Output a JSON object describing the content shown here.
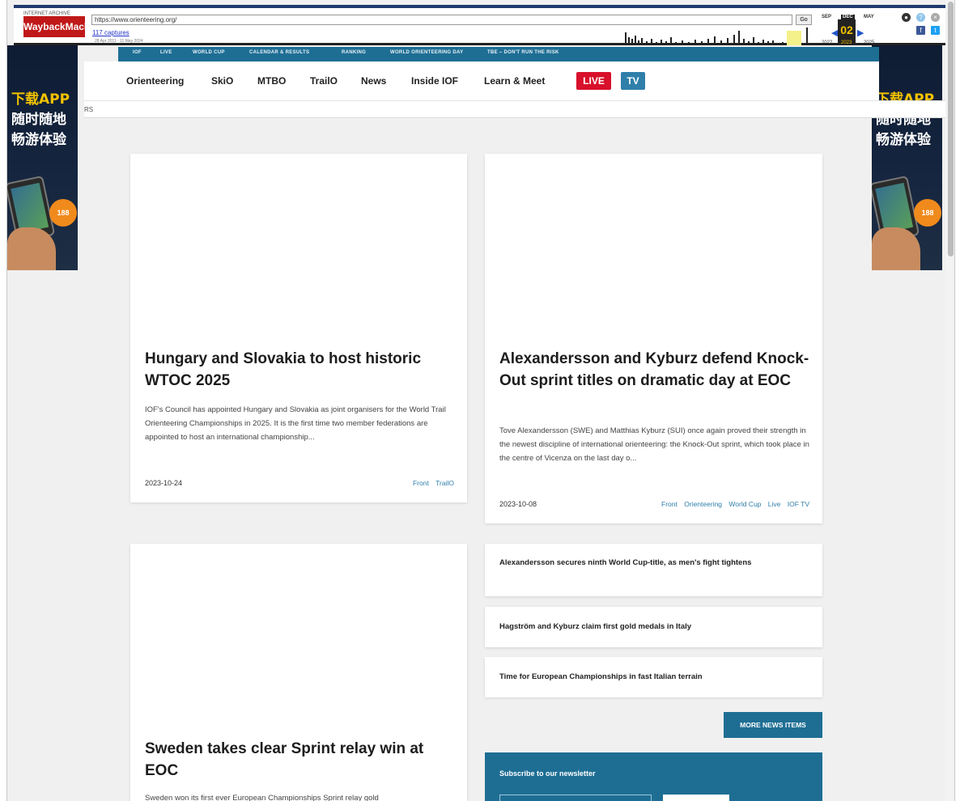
{
  "wayback": {
    "logo_top": "INTERNET ARCHIVE",
    "logo": "WaybackMachine",
    "url": "https://www.orienteering.org/",
    "go_label": "Go",
    "captures": "117 captures",
    "range": "28 Apr 2011 - 11 May 2024",
    "months": [
      "SEP",
      "DEC",
      "MAY"
    ],
    "day": "02",
    "years": [
      "2022",
      "2023",
      "2025"
    ]
  },
  "ad": {
    "line1": "下载APP",
    "line2": "随时随地",
    "line3": "畅游体验",
    "badge": "188"
  },
  "topbar": {
    "items": [
      "IOF",
      "LIVE",
      "WORLD CUP",
      "CALENDAR & RESULTS",
      "RANKING",
      "WORLD ORIENTEERING DAY",
      "TBE – DON'T RUN THE RISK"
    ]
  },
  "nav": {
    "items": [
      "Orienteering",
      "SkiO",
      "MTBO",
      "TrailO",
      "News",
      "Inside IOF",
      "Learn & Meet"
    ],
    "live": "LIVE",
    "tv": "TV"
  },
  "subbar": {
    "text": "RS"
  },
  "cards": [
    {
      "title": "Hungary and Slovakia to host historic WTOC 2025",
      "excerpt": "IOF's Council has appointed Hungary and Slovakia as joint organisers for the World Trail Orienteering Championships in 2025. It is the first time two member federations are appointed to host an international championship...",
      "date": "2023-10-24",
      "tags": [
        "Front",
        "TrailO"
      ]
    },
    {
      "title": "Alexandersson and Kyburz defend Knock-Out sprint titles on dramatic day at EOC",
      "excerpt": "Tove Alexandersson (SWE) and Matthias Kyburz (SUI) once again proved their strength in the newest discipline of international orienteering: the Knock-Out sprint, which took place in the centre of Vicenza on the last day o...",
      "date": "2023-10-08",
      "tags": [
        "Front",
        "Orienteering",
        "World Cup",
        "Live",
        "IOF TV"
      ]
    },
    {
      "title": "Sweden takes clear Sprint relay win at EOC",
      "excerpt": "Sweden won its first ever European Championships Sprint relay gold",
      "date": "",
      "tags": []
    }
  ],
  "news_list": [
    "Alexandersson secures ninth World Cup-title, as men's fight tightens",
    "Hagström and Kyburz claim first gold medals in Italy",
    "Time for European Championships in fast Italian terrain"
  ],
  "more_news": "MORE NEWS ITEMS",
  "newsletter": {
    "title": "Subscribe to our newsletter"
  },
  "colors": {
    "brand": "#1e6e94",
    "live": "#d8102a",
    "tv": "#2f7faa",
    "tag": "#2f7faa"
  }
}
